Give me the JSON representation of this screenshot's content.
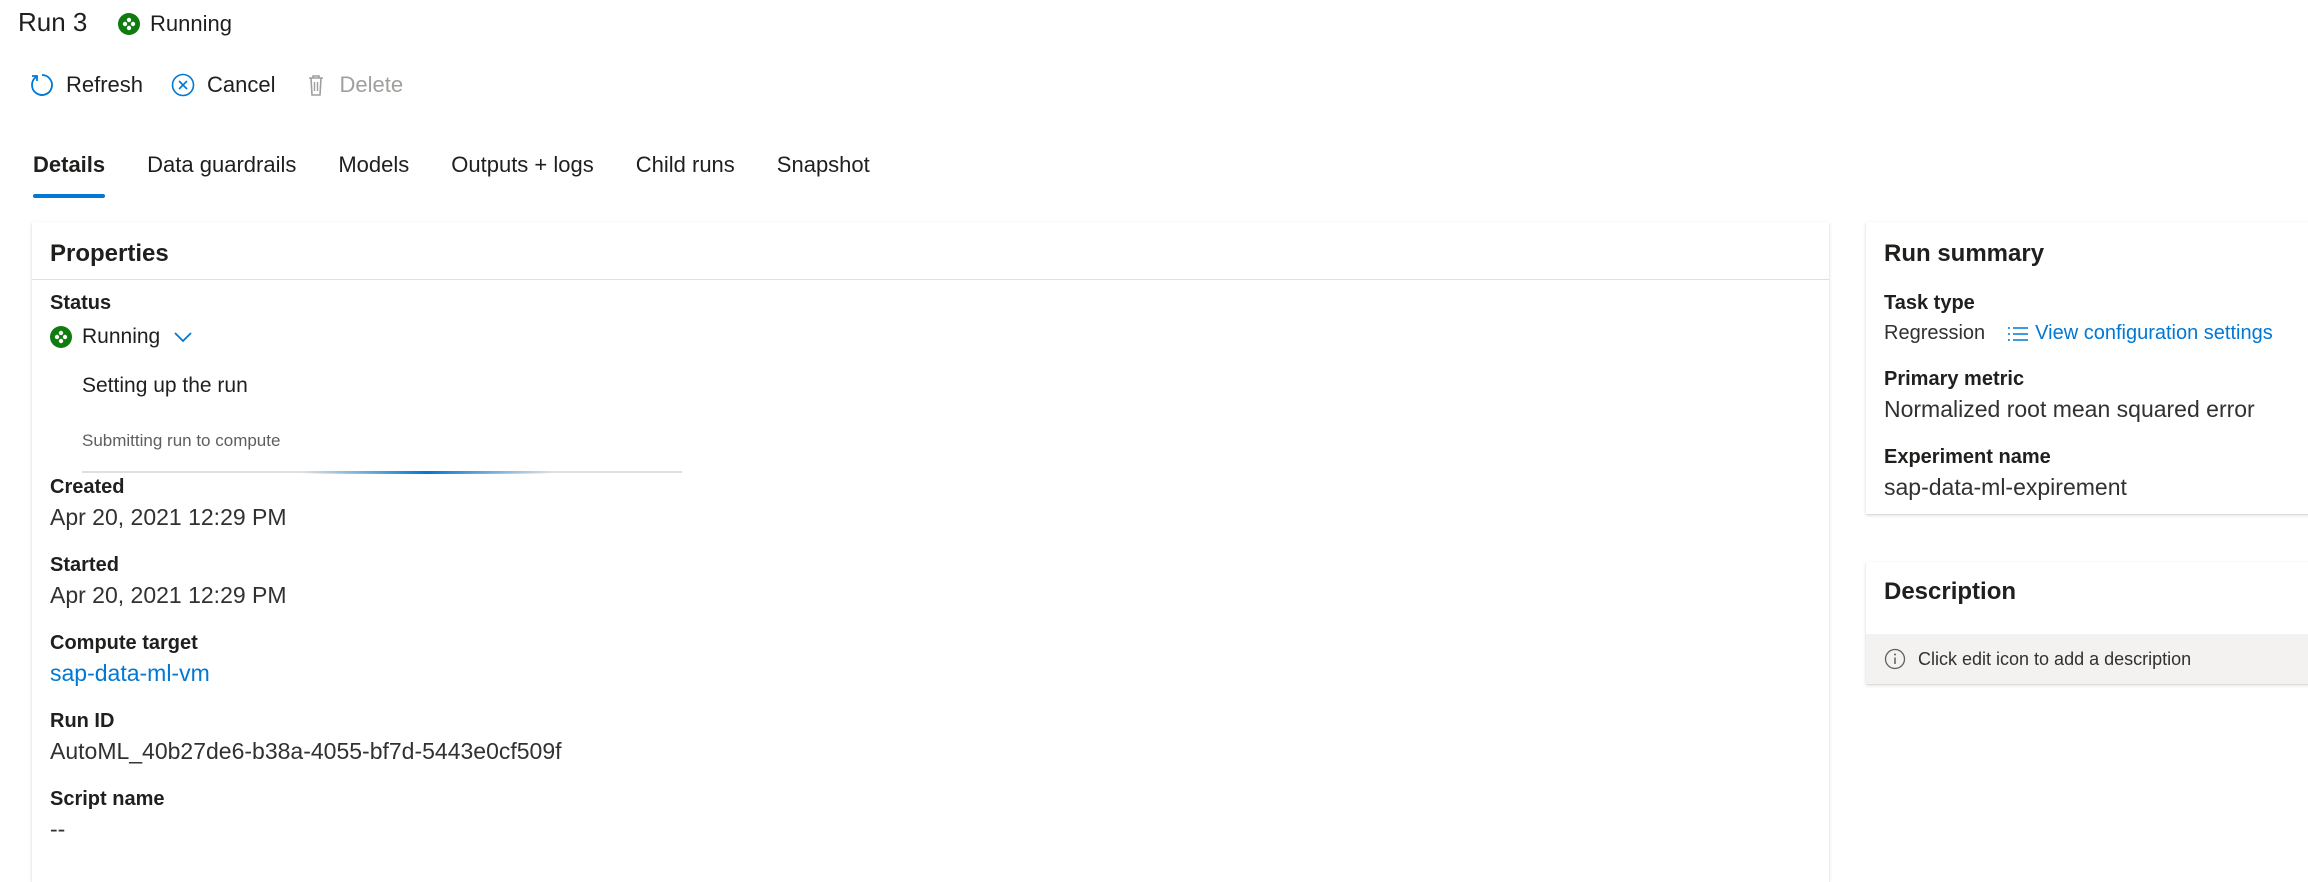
{
  "header": {
    "title": "Run 3",
    "status": "Running"
  },
  "toolbar": {
    "refresh_label": "Refresh",
    "cancel_label": "Cancel",
    "delete_label": "Delete"
  },
  "tabs": [
    {
      "label": "Details",
      "active": true
    },
    {
      "label": "Data guardrails"
    },
    {
      "label": "Models"
    },
    {
      "label": "Outputs + logs"
    },
    {
      "label": "Child runs"
    },
    {
      "label": "Snapshot"
    }
  ],
  "properties": {
    "title": "Properties",
    "status_label": "Status",
    "status_value": "Running",
    "progress_title": "Setting up the run",
    "progress_detail": "Submitting run to compute",
    "created_label": "Created",
    "created_value": "Apr 20, 2021 12:29 PM",
    "started_label": "Started",
    "started_value": "Apr 20, 2021 12:29 PM",
    "compute_label": "Compute target",
    "compute_value": "sap-data-ml-vm",
    "runid_label": "Run ID",
    "runid_value": "AutoML_40b27de6-b38a-4055-bf7d-5443e0cf509f",
    "script_label": "Script name",
    "script_value": "--"
  },
  "summary": {
    "title": "Run summary",
    "task_label": "Task type",
    "task_value": "Regression",
    "config_link": "View configuration settings",
    "metric_label": "Primary metric",
    "metric_value": "Normalized root mean squared error",
    "experiment_label": "Experiment name",
    "experiment_value": "sap-data-ml-expirement"
  },
  "description": {
    "title": "Description",
    "note": "Click edit icon to add a description"
  },
  "colors": {
    "accent": "#0078d4",
    "running": "#107c10",
    "disabled": "#a19f9d"
  }
}
